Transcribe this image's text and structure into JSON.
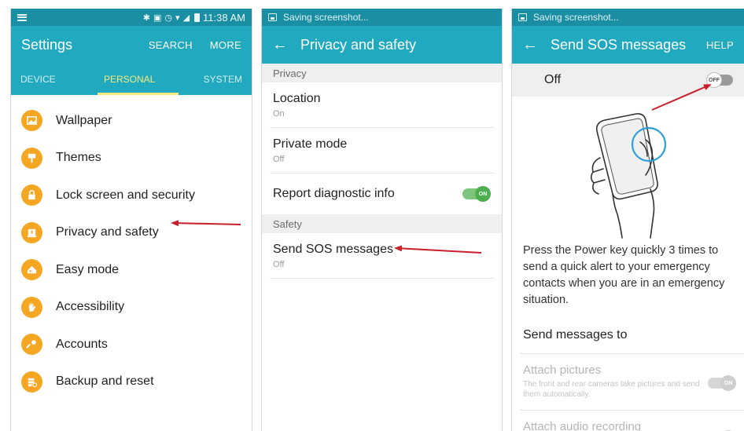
{
  "panel1": {
    "status_time": "11:38 AM",
    "app_title": "Settings",
    "actions": [
      "SEARCH",
      "MORE"
    ],
    "tabs": [
      "DEVICE",
      "PERSONAL",
      "SYSTEM"
    ],
    "active_tab": "PERSONAL",
    "items": [
      {
        "label": "Wallpaper",
        "icon": "wallpaper-icon"
      },
      {
        "label": "Themes",
        "icon": "brush-icon"
      },
      {
        "label": "Lock screen and security",
        "icon": "lock-icon"
      },
      {
        "label": "Privacy and safety",
        "icon": "privacy-icon"
      },
      {
        "label": "Easy mode",
        "icon": "easy-mode-icon"
      },
      {
        "label": "Accessibility",
        "icon": "hand-icon"
      },
      {
        "label": "Accounts",
        "icon": "key-icon"
      },
      {
        "label": "Backup and reset",
        "icon": "backup-icon"
      }
    ],
    "accent_color": "#21a9bf",
    "icon_color": "#f5a623"
  },
  "panel2": {
    "status_text": "Saving screenshot...",
    "app_title": "Privacy and safety",
    "section_privacy": "Privacy",
    "location": {
      "title": "Location",
      "sub": "On"
    },
    "private_mode": {
      "title": "Private mode",
      "sub": "Off"
    },
    "report": {
      "title": "Report diagnostic info",
      "toggle": "ON"
    },
    "section_safety": "Safety",
    "sos": {
      "title": "Send SOS messages",
      "sub": "Off"
    }
  },
  "panel3": {
    "status_text": "Saving screenshot...",
    "app_title": "Send SOS messages",
    "help": "HELP",
    "master_label": "Off",
    "master_toggle": "OFF",
    "description": "Press the Power key quickly 3 times to send a quick alert to your emergency contacts when you are in an emergency situation.",
    "send_to": "Send messages to",
    "attach_pictures": {
      "title": "Attach pictures",
      "sub": "The front and rear cameras take pictures and send them automatically.",
      "toggle": "ON"
    },
    "attach_audio": {
      "title": "Attach audio recording"
    }
  },
  "annotation_color": "#c8202a"
}
